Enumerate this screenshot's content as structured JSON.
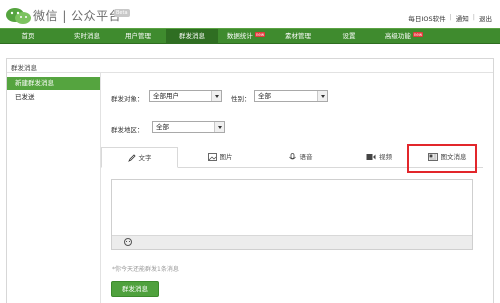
{
  "header": {
    "logo_text": "微信 | 公众平台",
    "beta_badge": "Beta",
    "links": [
      "每日IOS软件",
      "通知",
      "退出"
    ]
  },
  "nav": {
    "items": [
      {
        "label": "首页"
      },
      {
        "label": "实时消息"
      },
      {
        "label": "用户管理"
      },
      {
        "label": "群发消息"
      },
      {
        "label": "数据统计",
        "tag": "new"
      },
      {
        "label": "素材管理"
      },
      {
        "label": "设置"
      },
      {
        "label": "高级功能",
        "tag": "new"
      }
    ],
    "active_index": 3
  },
  "page": {
    "section_title": "群发消息",
    "sidebar": [
      "新建群发消息",
      "已发送"
    ]
  },
  "form": {
    "target_label": "群发对象：",
    "target_value": "全部用户",
    "gender_label": "性别：",
    "gender_value": "全部",
    "region_label": "群发地区：",
    "region_value": "全部"
  },
  "tabs": [
    "文字",
    "图片",
    "语音",
    "视频",
    "图文消息"
  ],
  "hint": "*你今天还能群发1条消息",
  "send_button": "群发消息",
  "colors": {
    "nav_green": "#3f8b2e",
    "active_green": "#55a43f",
    "highlight_red": "#e2262b"
  }
}
